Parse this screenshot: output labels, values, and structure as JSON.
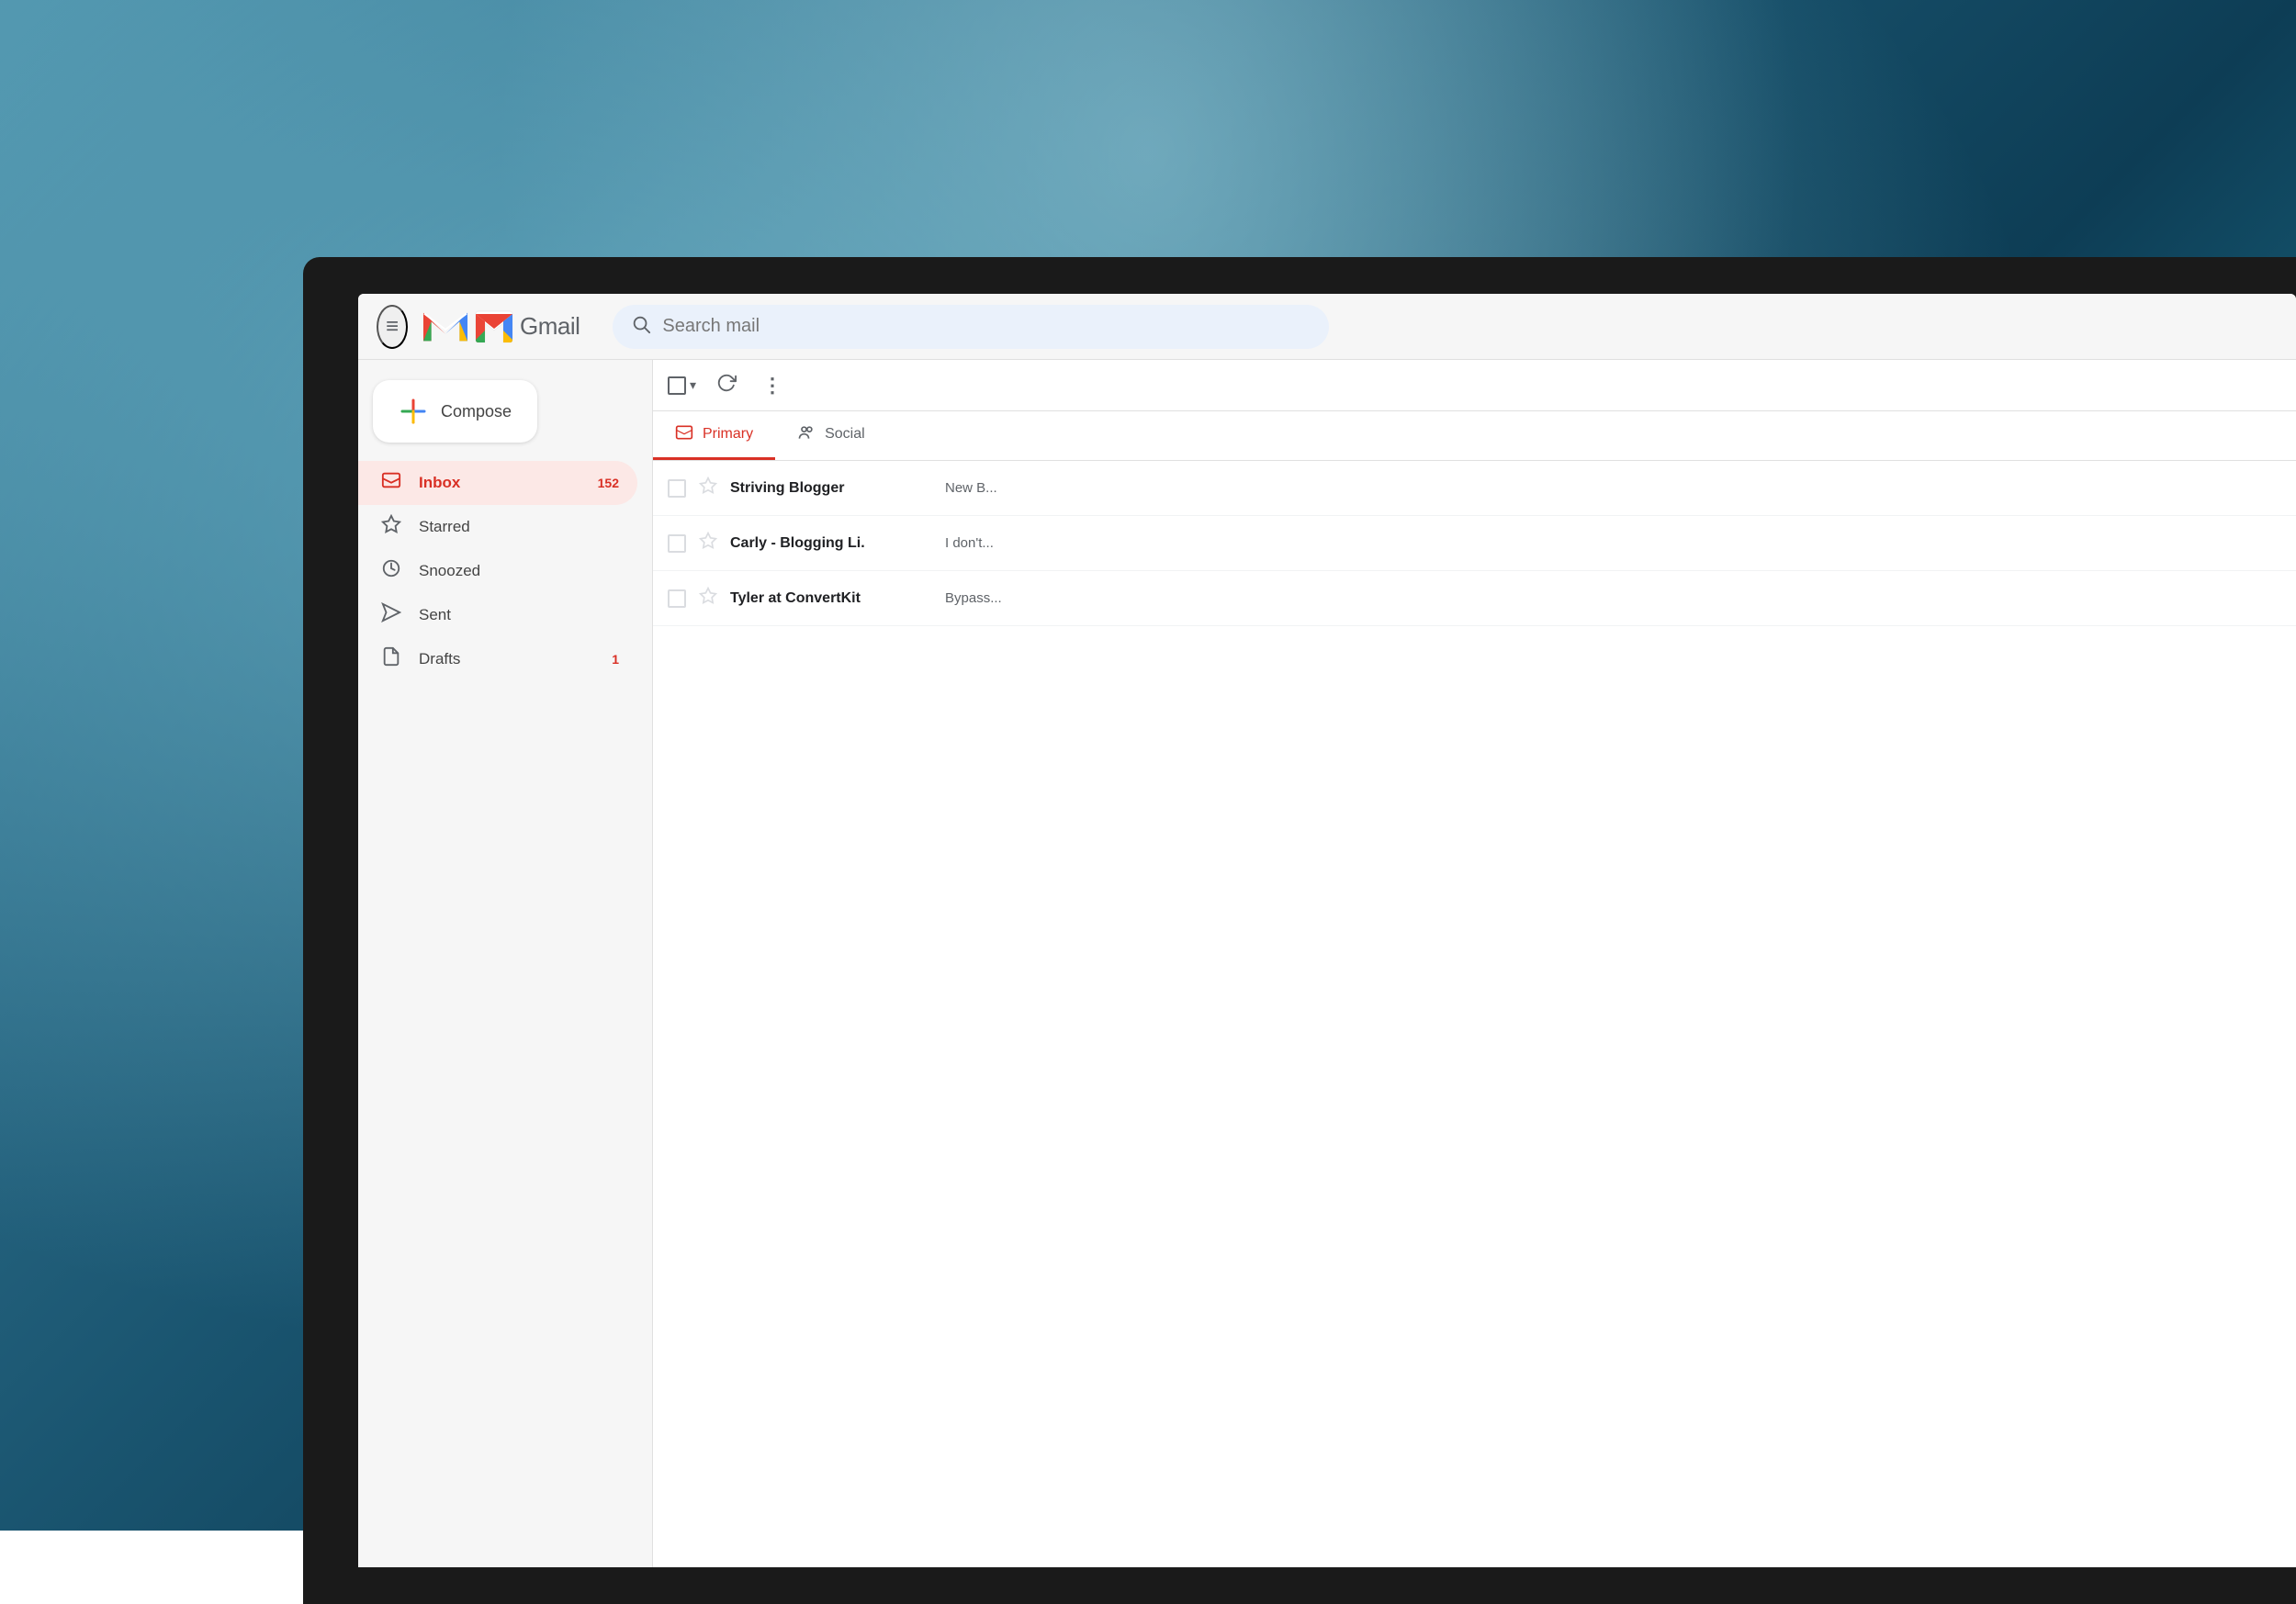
{
  "background": {
    "color1": "#4a8fa8",
    "color2": "#0d3d55"
  },
  "header": {
    "menu_label": "≡",
    "logo_text": "Gmail",
    "search_placeholder": "Search mail"
  },
  "compose": {
    "label": "Compose",
    "plus_symbol": "+"
  },
  "nav": {
    "items": [
      {
        "id": "inbox",
        "label": "Inbox",
        "badge": "152",
        "active": true
      },
      {
        "id": "starred",
        "label": "Starred",
        "badge": "",
        "active": false
      },
      {
        "id": "snoozed",
        "label": "Snoozed",
        "badge": "",
        "active": false
      },
      {
        "id": "sent",
        "label": "Sent",
        "badge": "",
        "active": false
      },
      {
        "id": "drafts",
        "label": "Drafts",
        "badge": "1",
        "active": false
      }
    ]
  },
  "toolbar": {
    "select_all_label": "",
    "refresh_label": "↻",
    "more_label": "⋮"
  },
  "tabs": [
    {
      "id": "primary",
      "label": "Primary",
      "active": true
    },
    {
      "id": "social",
      "label": "Social",
      "active": false
    }
  ],
  "emails": [
    {
      "sender": "Striving Blogger",
      "preview": "New B...",
      "starred": false
    },
    {
      "sender": "Carly - Blogging Li.",
      "preview": "I don't...",
      "starred": false
    },
    {
      "sender": "Tyler at ConvertKit",
      "preview": "Bypass...",
      "starred": false
    }
  ]
}
